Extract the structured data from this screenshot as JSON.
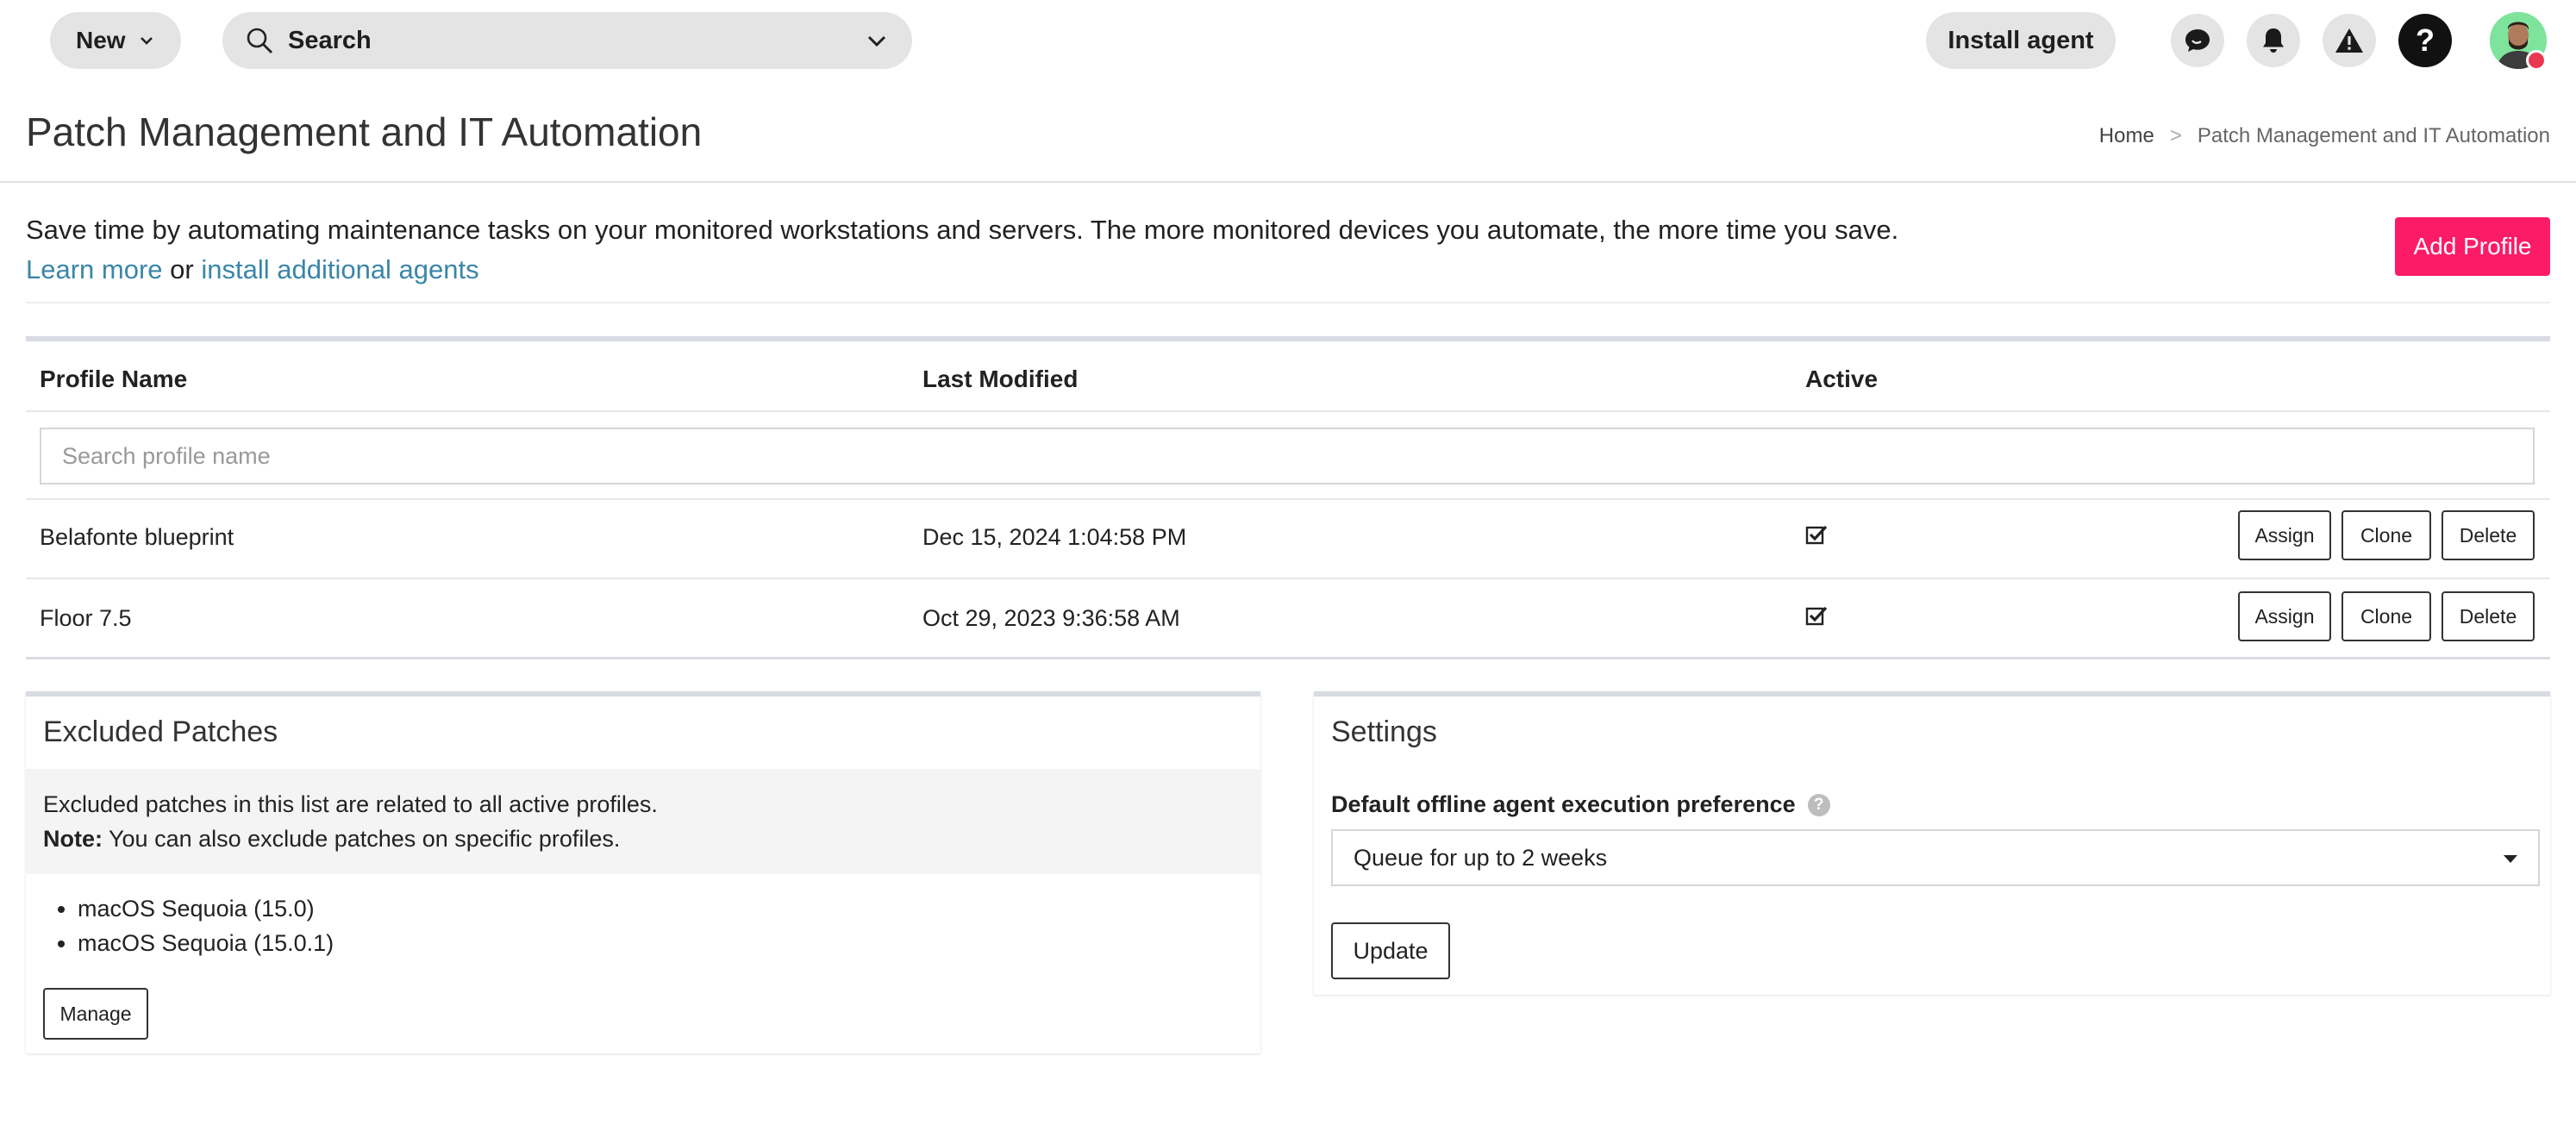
{
  "topbar": {
    "new_label": "New",
    "search_label": "Search",
    "install_label": "Install agent"
  },
  "header": {
    "title": "Patch Management and IT Automation",
    "breadcrumb": [
      "Home",
      ">",
      "Patch Management and IT Automation"
    ]
  },
  "intro": {
    "text": "Save time by automating maintenance tasks on your monitored workstations and servers. The more monitored devices you automate, the more time you save.",
    "learn_more": "Learn more",
    "or": "or",
    "install_link": "install additional agents"
  },
  "add_profile_label": "Add Profile",
  "table": {
    "headers": [
      "Profile Name",
      "Last Modified",
      "Active"
    ],
    "search_placeholder": "Search profile name",
    "rows": [
      {
        "name": "Belafonte blueprint",
        "modified": "Dec 15, 2024 1:04:58 PM",
        "active": true
      },
      {
        "name": "Floor 7.5",
        "modified": "Oct 29, 2023 9:36:58 AM",
        "active": true
      }
    ],
    "actions": [
      "Assign",
      "Clone",
      "Delete"
    ]
  },
  "excluded": {
    "title": "Excluded Patches",
    "line1": "Excluded patches in this list are related to all active profiles.",
    "note_label": "Note:",
    "note_text": "You can also exclude patches on specific profiles.",
    "items": [
      "macOS Sequoia (15.0)",
      "macOS Sequoia (15.0.1)"
    ],
    "manage_label": "Manage"
  },
  "settings": {
    "title": "Settings",
    "label": "Default offline agent execution preference",
    "help": "?",
    "selected": "Queue for up to 2 weeks",
    "update_label": "Update"
  },
  "colors": {
    "accent": "#fc1b66",
    "link": "#3a86a8"
  },
  "icons": [
    "search-icon",
    "chevron-down-icon",
    "chat-icon",
    "bell-icon",
    "warning-icon",
    "help-icon",
    "checkbox-checked-icon"
  ]
}
